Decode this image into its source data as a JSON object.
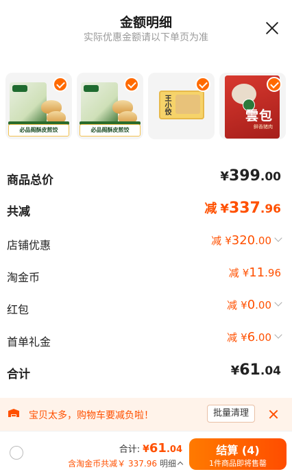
{
  "header": {
    "title": "金额明细",
    "subtitle": "实际优惠金额请以下单页为准"
  },
  "products": [
    {
      "caption": "必品阁酥皮煎饺",
      "brand": "必品阁",
      "selected": true
    },
    {
      "caption": "必品阁酥皮煎饺",
      "brand": "必品阁",
      "selected": true
    },
    {
      "pack_text": "王小饺",
      "selected": true
    },
    {
      "pack_text": "雲包",
      "pack_subtext": "鲜香猪肉",
      "selected": true
    }
  ],
  "rows": {
    "goods_total": {
      "label": "商品总价",
      "yen": "¥",
      "int": "399",
      "dec": ".00"
    },
    "total_discount": {
      "label": "共减",
      "prefix": "减",
      "yen": "¥",
      "int": "337",
      "dec": ".96"
    },
    "store_discount": {
      "label": "店铺优惠",
      "prefix": "减",
      "yen": "¥",
      "int": "320",
      "dec": ".00"
    },
    "taojinbi": {
      "label": "淘金币",
      "prefix": "减",
      "yen": "¥",
      "int": "11",
      "dec": ".96"
    },
    "red_packet": {
      "label": "红包",
      "prefix": "减",
      "yen": "¥",
      "int": "0",
      "dec": ".00"
    },
    "first_gift": {
      "label": "首单礼金",
      "prefix": "减",
      "yen": "¥",
      "int": "6",
      "dec": ".00"
    },
    "sum": {
      "label": "合计",
      "yen": "¥",
      "int": "61",
      "dec": ".04"
    }
  },
  "notice": {
    "message": "宝贝太多，购物车要减负啦！",
    "button": "批量清理"
  },
  "footer": {
    "total_label": "合计:",
    "total_yen": "¥",
    "total_int": "61",
    "total_dec": ".04",
    "detail_text": "含淘金币共减￥ 337.96",
    "detail_link": "明细",
    "checkout_label": "结算 (4)",
    "checkout_sub": "1件商品即将售罄"
  },
  "colors": {
    "accent": "#ff5000",
    "checkout_start": "#ff7a00",
    "checkout_end": "#ff4d00",
    "notice_bg": "#fff3ea"
  },
  "icons": [
    "close-icon",
    "check-icon",
    "chevron-down-icon",
    "truck-icon",
    "chevron-up-icon"
  ]
}
